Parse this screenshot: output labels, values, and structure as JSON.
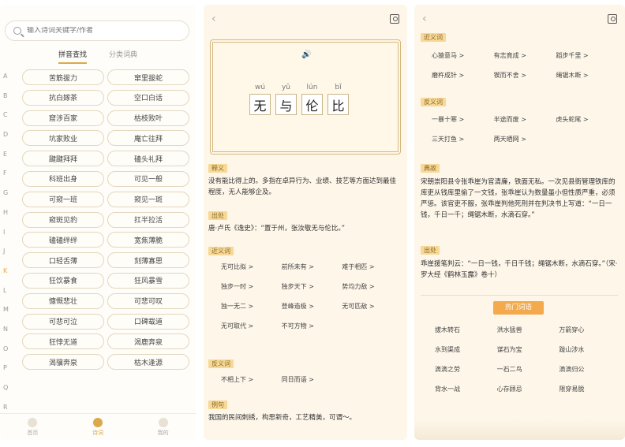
{
  "panel1": {
    "search_placeholder": "输入诗词关键字/作者",
    "tabs": [
      "拼音查找",
      "分类词典"
    ],
    "alphabet": [
      "A",
      "B",
      "C",
      "D",
      "E",
      "F",
      "G",
      "H",
      "I",
      "J",
      "K",
      "L",
      "M",
      "N",
      "O",
      "P",
      "Q",
      "R"
    ],
    "idioms": [
      "苦筋拔力",
      "窜里拔蛇",
      "抗白嫁茶",
      "空口白话",
      "窟涉百家",
      "枯枝败叶",
      "坑家败业",
      "庵亡往拜",
      "踺踺拜拜",
      "磕头礼拜",
      "科班出身",
      "可见一般",
      "可窥一班",
      "窥见一斑",
      "窥斑见豹",
      "扛半拉活",
      "磕磕绊绊",
      "宽焦薄脆",
      "口轻舌薄",
      "刻薄寡思",
      "狂饮暴食",
      "狂风暴雪",
      "慷慨悲壮",
      "可悲可叹",
      "可悲可泣",
      "口碑载道",
      "狂悖无道",
      "渴鹿奔泉",
      "渴骥奔泉",
      "枯木逢源"
    ],
    "nav": [
      "首页",
      "诗词",
      "我的"
    ]
  },
  "panel2": {
    "chars": [
      {
        "py": "wú",
        "ch": "无"
      },
      {
        "py": "yǔ",
        "ch": "与"
      },
      {
        "py": "lún",
        "ch": "伦"
      },
      {
        "py": "bǐ",
        "ch": "比"
      }
    ],
    "sec_meaning": "释义",
    "meaning": "没有能比得上的。多指在卓异行为、业绩、技艺等方面达到最佳程度，无人能够企及。",
    "sec_source": "出处",
    "source": "唐·卢氏《逸史》：“置于州，张汝敬无与伦比。”",
    "sec_syn": "近义词",
    "synonyms": [
      "无可比拟 >",
      "前所未有 >",
      "难于相匹 >",
      "独步一时 >",
      "独步天下 >",
      "势均力敌 >",
      "独一无二 >",
      "登峰造极 >",
      "无可匹敌 >",
      "无可取代 >",
      "不可方物 >"
    ],
    "sec_ant": "反义词",
    "antonyms": [
      "不相上下 >",
      "同日而语 >"
    ],
    "sec_example": "例句",
    "example": "我国的民间刺绣，构思新奇，工艺精美，可谓～。"
  },
  "panel3": {
    "sec_syn": "近义词",
    "synonyms": [
      "心猿意马 >",
      "有志竟成 >",
      "蹈步千里 >",
      "磨杵成针 >",
      "锲而不舍 >",
      "绳锯木断 >"
    ],
    "sec_ant": "反义词",
    "antonyms": [
      "一暴十寒 >",
      "半途而废 >",
      "虎头蛇尾 >",
      "三天打鱼 >",
      "两天晒网 >"
    ],
    "sec_story": "典故",
    "story": "宋朝崇阳县令张乖崖为官清廉，铁面无私。一次见县衙管理铁库的库吏从钱库里偷了一文钱，张乖崖认为数量虽小但性质严重，必须严惩。该官吏不服，张乖崖判他死刑并在判决书上写道：“一日一钱，千日一千；绳锯木断，水滴石穿。”",
    "sec_origin": "出处",
    "origin": "乖崖援笔判云：“一日一钱，千日千钱；绳锯木断，水滴石穿。”（宋·罗大经《鹤林玉露》卷十）",
    "hot_label": "热门词语",
    "hot_words": [
      "拔木转石",
      "洪水猛兽",
      "万箭穿心",
      "水到渠成",
      "谋石为宝",
      "跋山涉水",
      "滴滴之劳",
      "一石二鸟",
      "滴滴归公",
      "背水一战",
      "心存顾忌",
      "限穿易脱"
    ]
  },
  "colors": {
    "accent": "#d9a94a",
    "tag_bg": "#f7d897",
    "hot_bg": "#f3a94c",
    "card_bg": "#fff8e9"
  }
}
